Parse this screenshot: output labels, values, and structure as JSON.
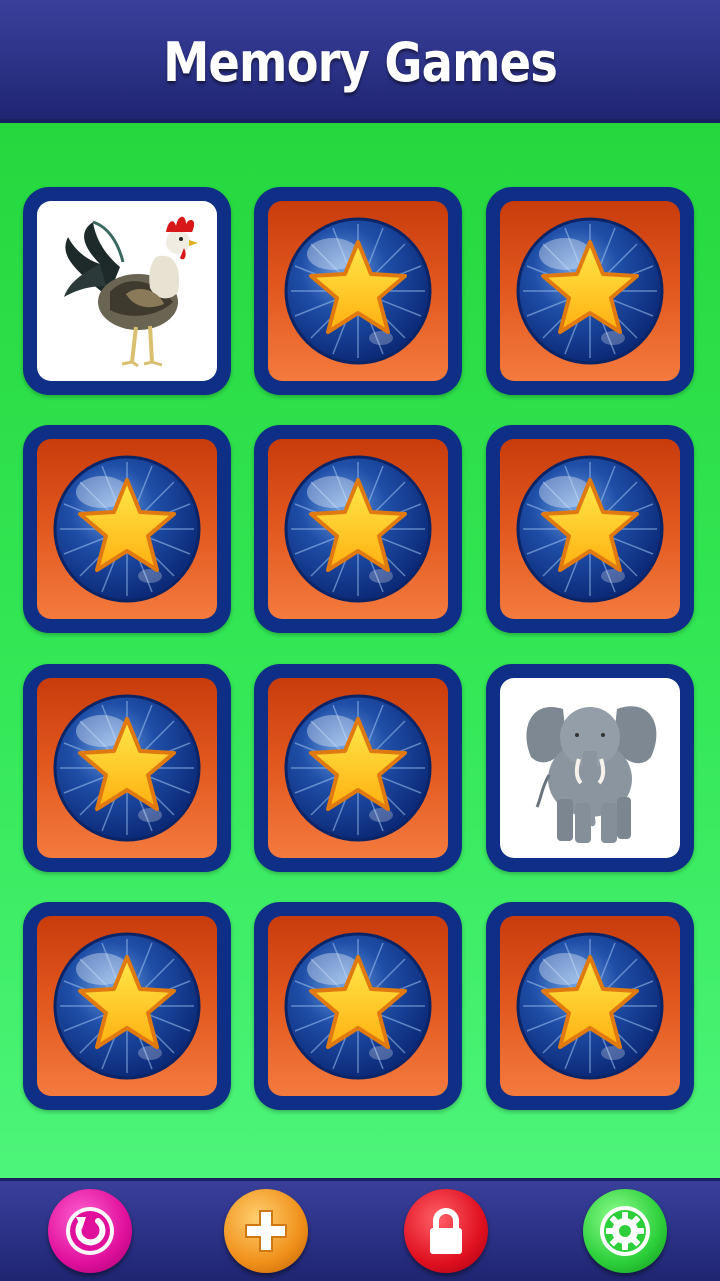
{
  "header": {
    "title": "Memory Games"
  },
  "board": {
    "cards": [
      {
        "state": "face-up",
        "animal": "rooster"
      },
      {
        "state": "face-down",
        "icon": "star-icon"
      },
      {
        "state": "face-down",
        "icon": "star-icon"
      },
      {
        "state": "face-down",
        "icon": "star-icon"
      },
      {
        "state": "face-down",
        "icon": "star-icon"
      },
      {
        "state": "face-down",
        "icon": "star-icon"
      },
      {
        "state": "face-down",
        "icon": "star-icon"
      },
      {
        "state": "face-down",
        "icon": "star-icon"
      },
      {
        "state": "face-up",
        "animal": "elephant"
      },
      {
        "state": "face-down",
        "icon": "star-icon"
      },
      {
        "state": "face-down",
        "icon": "star-icon"
      },
      {
        "state": "face-down",
        "icon": "star-icon"
      }
    ]
  },
  "toolbar": {
    "buttons": [
      {
        "name": "restart-button",
        "icon": "restart-icon",
        "color": "#e0109c"
      },
      {
        "name": "add-button",
        "icon": "plus-icon",
        "color": "#f0901a"
      },
      {
        "name": "lock-button",
        "icon": "lock-icon",
        "color": "#e01020"
      },
      {
        "name": "settings-button",
        "icon": "gear-icon",
        "color": "#2ccf3a"
      }
    ]
  },
  "colors": {
    "header": "#2c3286",
    "board": "#34e857",
    "card_border": "#0f2f86",
    "card_back": "#e0561d",
    "star": "#ffc81e"
  }
}
